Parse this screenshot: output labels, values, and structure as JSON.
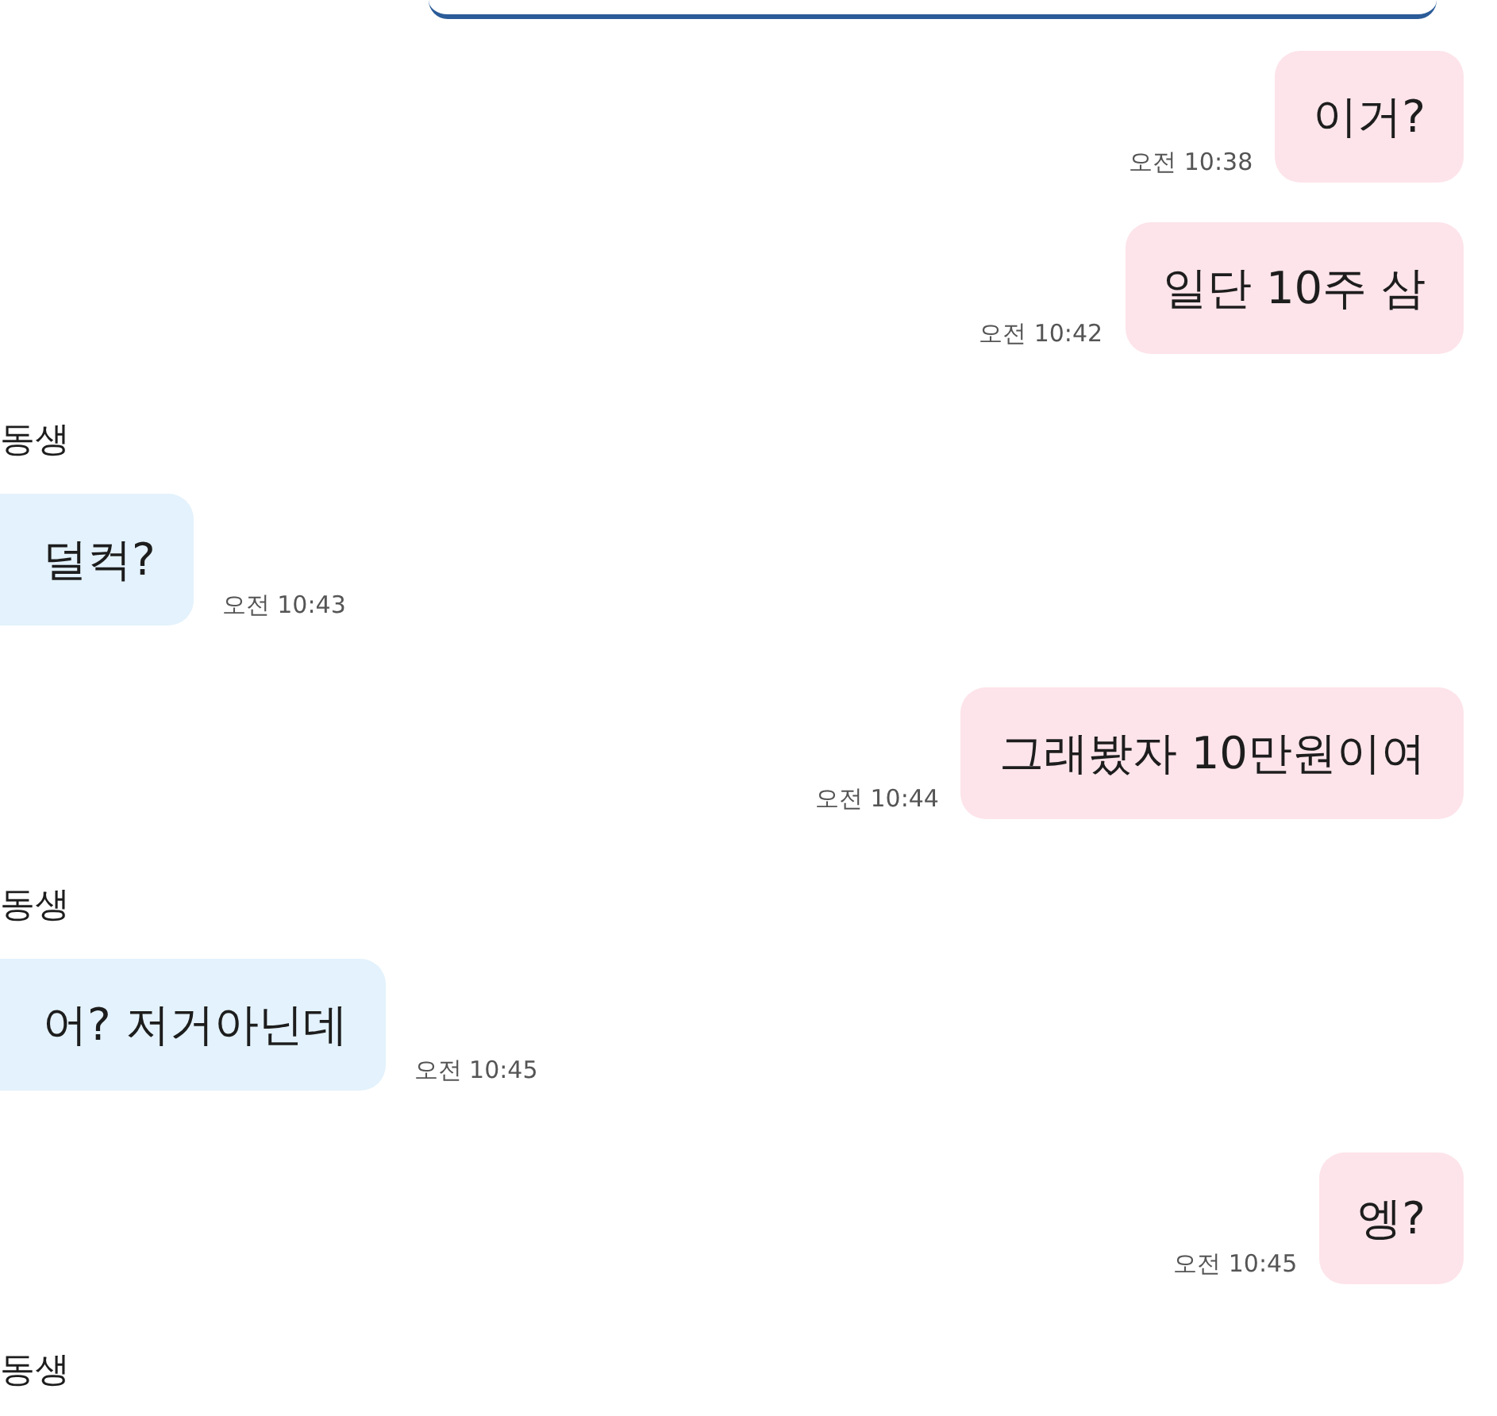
{
  "messages": [
    {
      "kind": "card"
    },
    {
      "kind": "sent",
      "text": "이거?",
      "time": "오전 10:38"
    },
    {
      "kind": "sent",
      "text": "일단 10주 삼",
      "time": "오전 10:42"
    },
    {
      "kind": "sender",
      "name": "동생"
    },
    {
      "kind": "received",
      "text": "덜컥?",
      "time": "오전 10:43"
    },
    {
      "kind": "sent",
      "text": "그래봤자 10만원이여",
      "time": "오전 10:44"
    },
    {
      "kind": "sender",
      "name": "동생"
    },
    {
      "kind": "received",
      "text": "어? 저거아닌데",
      "time": "오전 10:45"
    },
    {
      "kind": "sent",
      "text": "엥?",
      "time": "오전 10:45"
    },
    {
      "kind": "sender",
      "name": "동생"
    }
  ]
}
